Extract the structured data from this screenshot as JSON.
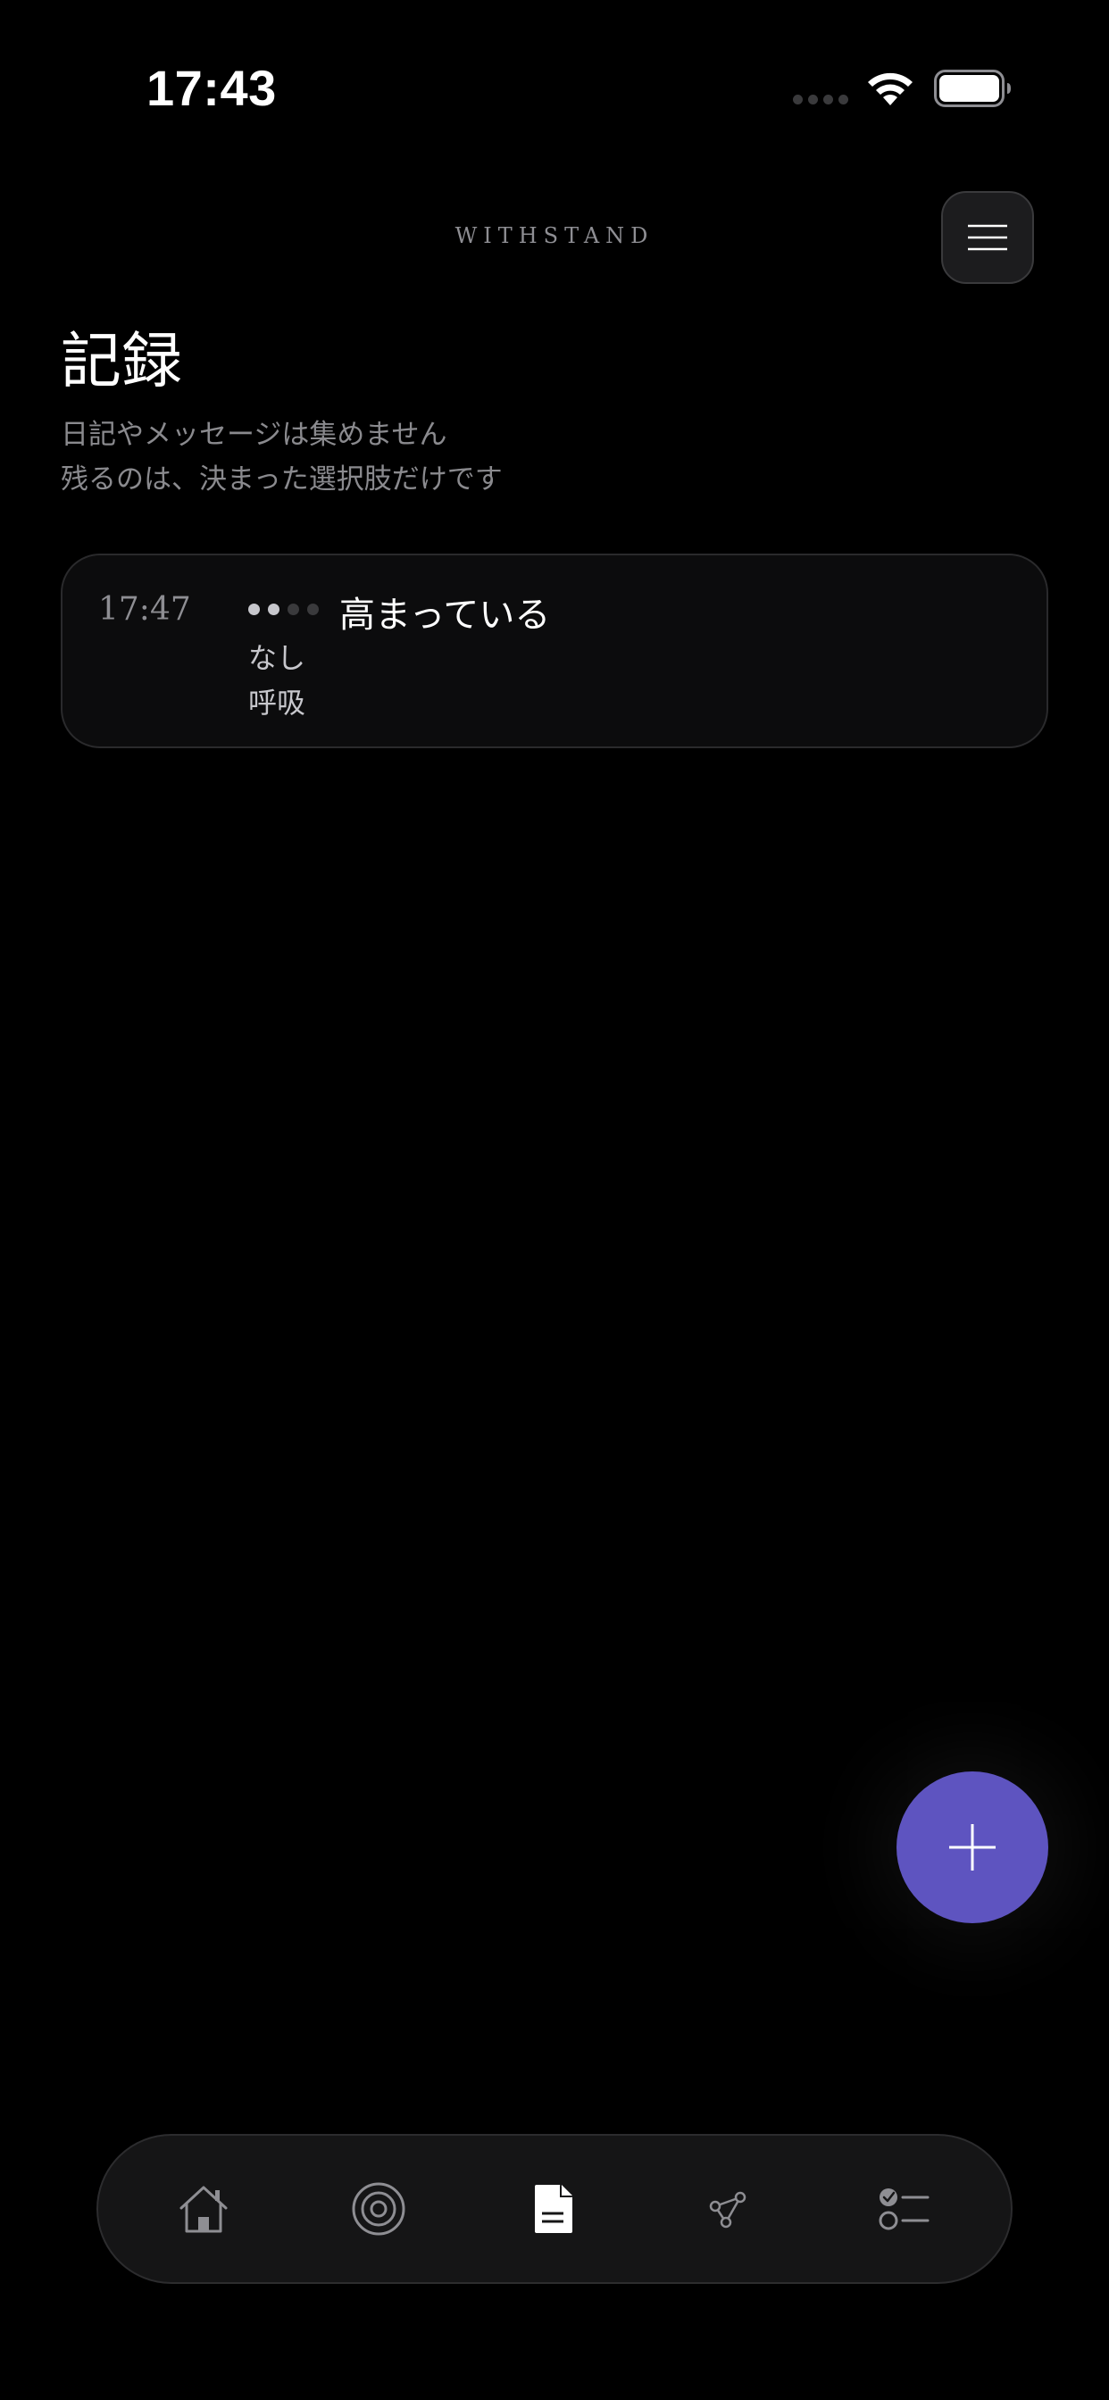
{
  "status_bar": {
    "time": "17:43"
  },
  "header": {
    "brand": "WITHSTAND",
    "menu_icon": "hamburger-menu-icon"
  },
  "page": {
    "title": "記録",
    "subtitle_line1": "日記やメッセージは集めません",
    "subtitle_line2": "残るのは、決まった選択肢だけです"
  },
  "records": [
    {
      "time": "17:47",
      "level": 2,
      "level_max": 4,
      "state": "高まっている",
      "line1": "なし",
      "line2": "呼吸"
    }
  ],
  "fab": {
    "icon": "plus-icon",
    "color": "#5e54c0"
  },
  "tab_bar": {
    "tabs": [
      {
        "icon": "home-icon",
        "active": false
      },
      {
        "icon": "target-icon",
        "active": false
      },
      {
        "icon": "document-icon",
        "active": true
      },
      {
        "icon": "connections-icon",
        "active": false
      },
      {
        "icon": "checklist-icon",
        "active": false
      }
    ]
  },
  "colors": {
    "background": "#000000",
    "accent": "#5e54c0",
    "muted_text": "#8e8e93",
    "card_background": "#0c0c0d",
    "tab_inactive": "#8e8e93",
    "tab_active": "#ffffff"
  }
}
